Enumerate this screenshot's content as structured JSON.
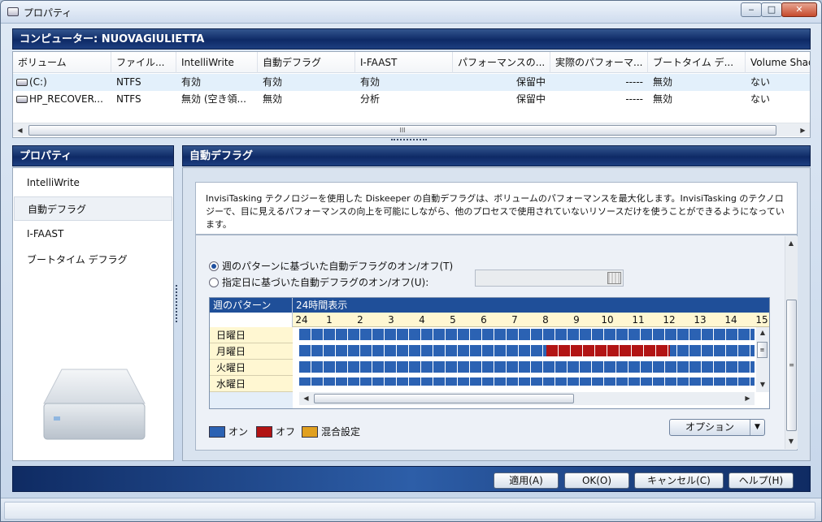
{
  "window": {
    "title": "プロパティ",
    "min": "‒",
    "max": "□",
    "close": "✕"
  },
  "computer_bar": "コンピューター: NUOVAGIULIETTA",
  "volumes": {
    "columns": [
      "ボリューム",
      "ファイル...",
      "IntelliWrite",
      "自動デフラグ",
      "I-FAAST",
      "パフォーマンスの...",
      "実際のパフォーマ...",
      "ブートタイム デ...",
      "Volume Shad"
    ],
    "rows": [
      [
        "(C:)",
        "NTFS",
        "有効",
        "有効",
        "有効",
        "保留中",
        "-----",
        "無効",
        "ない"
      ],
      [
        "HP_RECOVER...",
        "NTFS",
        "無効 (空き領...",
        "無効",
        "分析",
        "保留中",
        "-----",
        "無効",
        "ない"
      ]
    ],
    "scroll_grip": "III"
  },
  "properties": {
    "header": "プロパティ",
    "items": [
      "IntelliWrite",
      "自動デフラグ",
      "I-FAAST",
      "ブートタイム デフラグ"
    ],
    "selected": 1
  },
  "defrag": {
    "header": "自動デフラグ",
    "description": "InvisiTasking テクノロジーを使用した Diskeeper の自動デフラグは、ボリュームのパフォーマンスを最大化します。InvisiTasking のテクノロジーで、目に見えるパフォーマンスの向上を可能にしながら、他のプロセスで使用されていないリソースだけを使うことができるようになっています。",
    "radio_weekly": "週のパターンに基づいた自動デフラグのオン/オフ(T)",
    "radio_date": "指定日に基づいた自動デフラグのオン/オフ(U):",
    "weekly_selected": true,
    "grid": {
      "corner": "週のパターン",
      "mode": "24時間表示",
      "hours": [
        "24",
        "1",
        "2",
        "3",
        "4",
        "5",
        "6",
        "7",
        "8",
        "9",
        "10",
        "11",
        "12",
        "13",
        "14",
        "15"
      ],
      "days": [
        "日曜日",
        "月曜日",
        "火曜日",
        "水曜日"
      ],
      "off_block": {
        "day": "月曜日",
        "from_hour": 8,
        "to_hour": 12
      }
    },
    "legend": [
      {
        "label": "オン",
        "color": "#2b62b3"
      },
      {
        "label": "オフ",
        "color": "#b21414"
      },
      {
        "label": "混合設定",
        "color": "#e0a020"
      }
    ],
    "options_button": "オプション"
  },
  "footer": {
    "apply": "適用(A)",
    "ok": "OK(O)",
    "cancel": "キャンセル(C)",
    "help": "ヘルプ(H)"
  }
}
